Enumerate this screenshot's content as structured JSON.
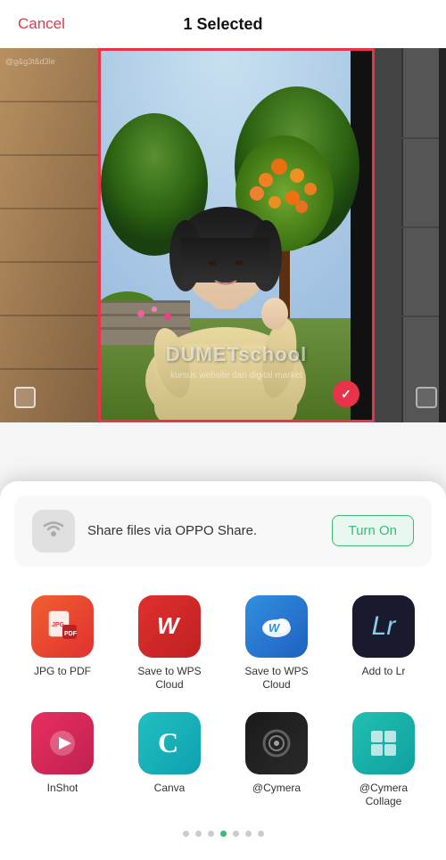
{
  "header": {
    "cancel_label": "Cancel",
    "title": "1 Selected"
  },
  "share": {
    "text": "Share files via OPPO Share.",
    "button_label": "Turn On"
  },
  "apps": [
    {
      "id": "jpg-pdf",
      "label": "JPG to PDF",
      "icon_class": "icon-jpg-pdf",
      "icon_symbol": "📄"
    },
    {
      "id": "wps-cloud-1",
      "label": "Save to WPS Cloud",
      "icon_class": "icon-wps-cloud1",
      "icon_symbol": "W"
    },
    {
      "id": "wps-cloud-2",
      "label": "Save to WPS Cloud",
      "icon_class": "icon-wps-cloud2",
      "icon_symbol": "W"
    },
    {
      "id": "add-to-lr",
      "label": "Add to Lr",
      "icon_class": "icon-lr",
      "icon_symbol": "Lr"
    },
    {
      "id": "inshot",
      "label": "InShot",
      "icon_class": "icon-inshot",
      "icon_symbol": "✂"
    },
    {
      "id": "canva",
      "label": "Canva",
      "icon_class": "icon-canva",
      "icon_symbol": "C"
    },
    {
      "id": "cymera",
      "label": "@Cymera",
      "icon_class": "icon-cymera",
      "icon_symbol": "⊙"
    },
    {
      "id": "cymera-collage",
      "label": "@Cymera Collage",
      "icon_class": "icon-cymera-collage",
      "icon_symbol": "⊞"
    }
  ],
  "pagination": {
    "total_dots": 7,
    "active_index": 3
  },
  "watermark": {
    "main": "DUMETschool",
    "sub": "kursus website dan digital market"
  }
}
